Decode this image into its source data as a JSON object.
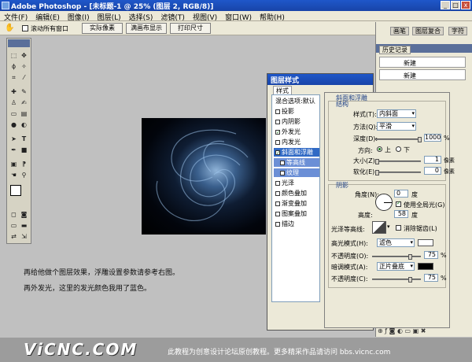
{
  "window": {
    "title": "Adobe Photoshop - [未标题-1 @ 25% (图层 2, RGB/8)]",
    "min": "_",
    "max": "□",
    "close": "x"
  },
  "menu": [
    "文件(F)",
    "编辑(E)",
    "图像(I)",
    "图层(L)",
    "选择(S)",
    "滤镜(T)",
    "视图(V)",
    "窗口(W)",
    "帮助(H)"
  ],
  "options": {
    "scroll_all": "滚动所有窗口",
    "actual_pixels": "实际像素",
    "fit_screen": "满画布显示",
    "print_size": "打印尺寸"
  },
  "panel_tabs": [
    "画笔",
    "图层复合",
    "字符"
  ],
  "history": {
    "title": "历史记录",
    "items": [
      "新建",
      "新建"
    ]
  },
  "dialog": {
    "title": "图层样式",
    "styles_header": "样式",
    "styles": [
      {
        "label": "混合选项:默认",
        "checked": false,
        "selected": false,
        "sub": false
      },
      {
        "label": "投影",
        "checked": false,
        "selected": false,
        "sub": false
      },
      {
        "label": "内阴影",
        "checked": false,
        "selected": false,
        "sub": false
      },
      {
        "label": "外发光",
        "checked": true,
        "selected": false,
        "sub": false
      },
      {
        "label": "内发光",
        "checked": false,
        "selected": false,
        "sub": false
      },
      {
        "label": "斜面和浮雕",
        "checked": true,
        "selected": true,
        "sub": false
      },
      {
        "label": "等高线",
        "checked": false,
        "selected": false,
        "sub": true
      },
      {
        "label": "纹理",
        "checked": false,
        "selected": false,
        "sub": true
      },
      {
        "label": "光泽",
        "checked": false,
        "selected": false,
        "sub": false
      },
      {
        "label": "颜色叠加",
        "checked": false,
        "selected": false,
        "sub": false
      },
      {
        "label": "渐变叠加",
        "checked": false,
        "selected": false,
        "sub": false
      },
      {
        "label": "图案叠加",
        "checked": false,
        "selected": false,
        "sub": false
      },
      {
        "label": "描边",
        "checked": false,
        "selected": false,
        "sub": false
      }
    ],
    "bevel": {
      "section": "斜面和浮雕",
      "structure": "结构",
      "style_label": "样式(T):",
      "style_value": "内斜面",
      "technique_label": "方法(Q):",
      "technique_value": "平滑",
      "depth_label": "深度(D):",
      "depth_value": "1000",
      "depth_unit": "%",
      "direction_label": "方向:",
      "dir_up": "上",
      "dir_down": "下",
      "size_label": "大小(Z):",
      "size_value": "1",
      "size_unit": "像素",
      "soften_label": "软化(E):",
      "soften_value": "0",
      "soften_unit": "像素"
    },
    "shading": {
      "section": "阴影",
      "angle_label": "角度(N):",
      "angle_value": "0",
      "angle_unit": "度",
      "global_light": "使用全局光(G)",
      "altitude_label": "高度:",
      "altitude_value": "58",
      "altitude_unit": "度",
      "gloss_label": "光泽等高线:",
      "antialias": "消除锯齿(L)",
      "highlight_label": "高光模式(H):",
      "highlight_mode": "滤色",
      "opacity1_label": "不透明度(O):",
      "opacity1_value": "75",
      "opacity_unit": "%",
      "shadow_label": "暗调模式(A):",
      "shadow_mode": "正片叠底",
      "opacity2_label": "不透明度(C):",
      "opacity2_value": "75",
      "highlight_color": "#ffffff",
      "shadow_color": "#000000"
    }
  },
  "captions": [
    "再给他做个图层效果，浮雕设置参数请参考右图。",
    "再外发光，这里的发光颜色我用了蓝色。"
  ],
  "footer": {
    "logo": "ViCNC.COM",
    "text": "此教程为创意设计论坛原创教程。更多精采作品请访问 bbs.vicnc.com"
  }
}
